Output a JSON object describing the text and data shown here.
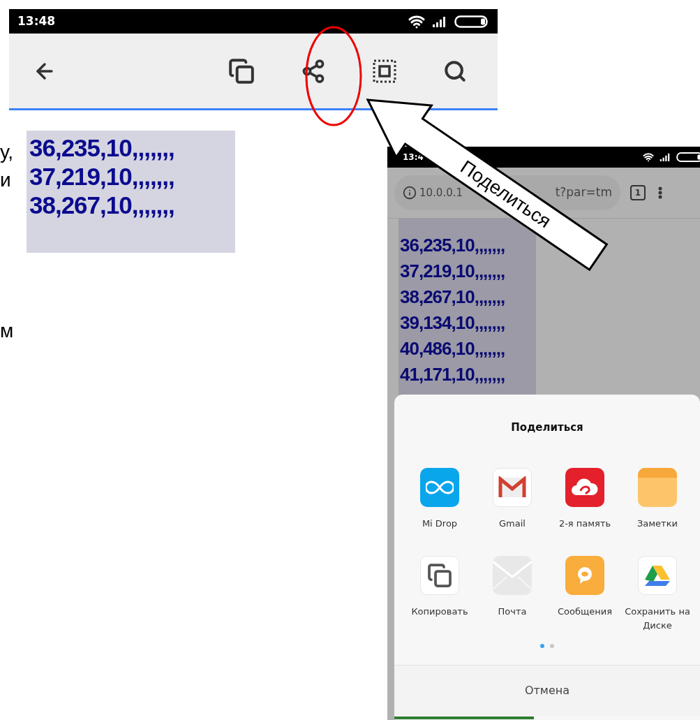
{
  "slide_text_fragments": [
    "у,",
    "и",
    "м"
  ],
  "top_screenshot": {
    "status_bar": {
      "time": "13:48"
    },
    "selection_rows": [
      "36,235,10,,,,,,,",
      "37,219,10,,,,,,,",
      "38,267,10,,,,,,,"
    ]
  },
  "callout": {
    "label": "Поделиться"
  },
  "bottom_screenshot": {
    "status_bar": {
      "time": "13:4"
    },
    "address_bar": {
      "url_start": "10.0.0.1",
      "url_end": "t?par=tm"
    },
    "tab_count": "1",
    "selection_rows": [
      "36,235,10,,,,,,,",
      "37,219,10,,,,,,,",
      "38,267,10,,,,,,,",
      "39,134,10,,,,,,,",
      "40,486,10,,,,,,,",
      "41,171,10,,,,,,,"
    ],
    "share_sheet": {
      "title": "Поделиться",
      "apps": [
        {
          "label": "Mi Drop",
          "kind": "midrop"
        },
        {
          "label": "Gmail",
          "kind": "gmail"
        },
        {
          "label": "2-я память",
          "kind": "cloud"
        },
        {
          "label": "Заметки",
          "kind": "notes"
        },
        {
          "label": "Копировать",
          "kind": "copy"
        },
        {
          "label": "Почта",
          "kind": "mail"
        },
        {
          "label": "Сообщения",
          "kind": "messages"
        },
        {
          "label": "Сохранить на Диске",
          "kind": "drive"
        }
      ],
      "page_dots": [
        {
          "selected": true
        },
        {
          "selected": false
        }
      ],
      "cancel": "Отмена"
    }
  }
}
